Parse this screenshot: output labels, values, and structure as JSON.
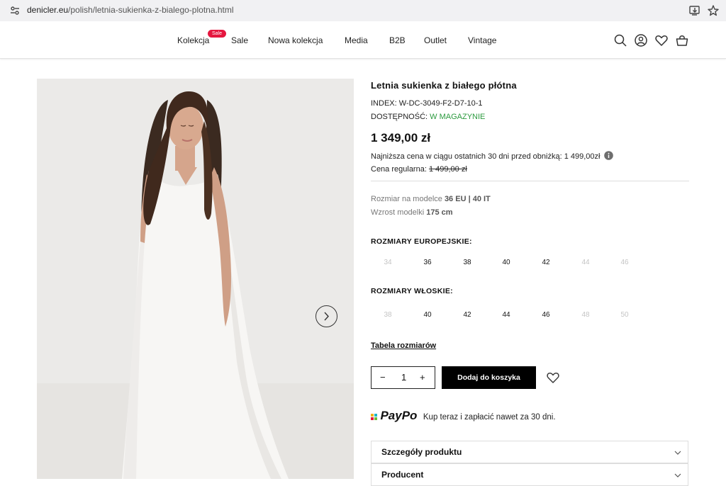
{
  "browser": {
    "url_domain": "denicler.eu",
    "url_path": "/polish/letnia-sukienka-z-bialego-plotna.html"
  },
  "nav": {
    "items": [
      "Kolekcja",
      "Sale",
      "Nowa kolekcja",
      "Media",
      "B2B",
      "Outlet",
      "Vintage"
    ],
    "badge": "Sale"
  },
  "product": {
    "title": "Letnia sukienka z białego płótna",
    "index_label": "INDEX:",
    "index_value": "W-DC-3049-F2-D7-10-1",
    "availability_label": "DOSTĘPNOŚĆ:",
    "availability_value": "W MAGAZYNIE",
    "price": "1 349,00 zł",
    "lowest_price_text": "Najniższa cena w ciągu ostatnich 30 dni przed obniżką: 1 499,00zł",
    "regular_price_label": "Cena regularna:",
    "regular_price_value": "1 499,00 zł",
    "model_size_label": "Rozmiar na modelce",
    "model_size_value": "36 EU | 40 IT",
    "model_height_label": "Wzrost modelki",
    "model_height_value": "175 cm",
    "eu_sizes_heading": "ROZMIARY EUROPEJSKIE:",
    "eu_sizes": [
      "34",
      "36",
      "38",
      "40",
      "42",
      "44",
      "46"
    ],
    "it_sizes_heading": "ROZMIARY WŁOSKIE:",
    "it_sizes": [
      "38",
      "40",
      "42",
      "44",
      "46",
      "48",
      "50"
    ],
    "size_table_link": "Tabela rozmiarów",
    "qty_minus": "−",
    "qty_value": "1",
    "qty_plus": "+",
    "add_to_cart": "Dodaj do koszyka",
    "paypo_logo": "PayPo",
    "paypo_text": "Kup teraz i zapłacić nawet za 30 dni.",
    "accordion": [
      "Szczegóły produktu",
      "Producent"
    ]
  },
  "colors": {
    "badge": "#e5173f",
    "availability": "#2b9a3e",
    "button": "#000000"
  }
}
